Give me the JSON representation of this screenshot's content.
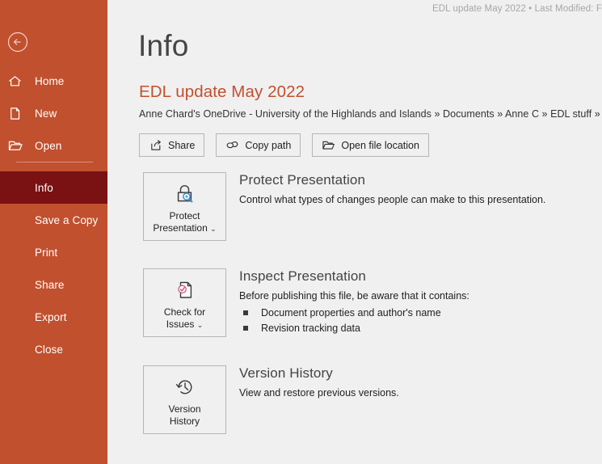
{
  "titlebar": {
    "text": "EDL update May 2022 • Last Modified: F"
  },
  "sidebar": {
    "back_label": "Back",
    "back_icon": "circled-left-arrow-icon",
    "top_items": [
      {
        "label": "Home",
        "icon": "home-icon"
      },
      {
        "label": "New",
        "icon": "new-document-icon"
      },
      {
        "label": "Open",
        "icon": "open-folder-icon"
      }
    ],
    "bottom_items": [
      {
        "label": "Info",
        "active": true
      },
      {
        "label": "Save a Copy",
        "active": false
      },
      {
        "label": "Print",
        "active": false
      },
      {
        "label": "Share",
        "active": false
      },
      {
        "label": "Export",
        "active": false
      },
      {
        "label": "Close",
        "active": false
      }
    ],
    "background_color": "#c1502e",
    "active_color": "#7a1113"
  },
  "main": {
    "page_title": "Info",
    "document_title": "EDL update May 2022",
    "document_title_color": "#c1502e",
    "document_path": "Anne Chard's OneDrive - University of the Highlands and Islands » Documents » Anne C » EDL stuff » SNLs",
    "actions": [
      {
        "label": "Share",
        "icon": "share-arrow-icon"
      },
      {
        "label": "Copy path",
        "icon": "link-chain-icon"
      },
      {
        "label": "Open file location",
        "icon": "folder-open-icon"
      }
    ],
    "features": [
      {
        "id": "protect",
        "tile_label_line1": "Protect",
        "tile_label_line2": "Presentation",
        "tile_has_caret": true,
        "tile_icon": "lock-magnifier-icon",
        "heading": "Protect Presentation",
        "description": "Control what types of changes people can make to this presentation.",
        "bullets": []
      },
      {
        "id": "inspect",
        "tile_label_line1": "Check for",
        "tile_label_line2": "Issues",
        "tile_has_caret": true,
        "tile_icon": "document-check-icon",
        "heading": "Inspect Presentation",
        "description": "Before publishing this file, be aware that it contains:",
        "bullets": [
          "Document properties and author's name",
          "Revision tracking data"
        ]
      },
      {
        "id": "version",
        "tile_label_line1": "Version",
        "tile_label_line2": "History",
        "tile_has_caret": false,
        "tile_icon": "clock-history-icon",
        "heading": "Version History",
        "description": "View and restore previous versions.",
        "bullets": []
      }
    ]
  }
}
